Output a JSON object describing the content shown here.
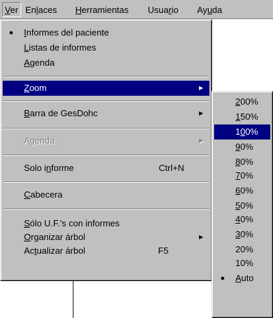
{
  "menubar": {
    "items": [
      {
        "label": "Ver",
        "underline": "V",
        "rest": "er"
      },
      {
        "label": "Enlaces",
        "pre": "En",
        "underline": "l",
        "rest": "aces"
      },
      {
        "label": "Herramientas",
        "underline": "H",
        "rest": "erramientas"
      },
      {
        "label": "Usuario",
        "pre": "Usua",
        "underline": "r",
        "rest": "io"
      },
      {
        "label": "Ayuda",
        "pre": "Ay",
        "underline": "u",
        "rest": "da"
      }
    ]
  },
  "view_menu": {
    "informes_paciente": {
      "underline": "I",
      "rest": "nformes del paciente"
    },
    "listas_informes": {
      "underline": "L",
      "rest": "istas de informes"
    },
    "agenda": {
      "underline": "A",
      "rest": "genda"
    },
    "zoom": {
      "underline": "Z",
      "rest": "oom"
    },
    "barra": {
      "underline": "B",
      "rest": "arra de GesDohc"
    },
    "agenda_disabled": "Agenda",
    "solo_informe": {
      "pre": "Solo i",
      "underline": "n",
      "rest": "forme",
      "shortcut": "Ctrl+N"
    },
    "cabecera": {
      "underline": "C",
      "rest": "abecera"
    },
    "solo_uf": {
      "underline": "S",
      "rest": "ólo U.F.'s con informes"
    },
    "organizar": {
      "underline": "O",
      "rest": "rganizar árbol"
    },
    "actualizar": {
      "pre": "Ac",
      "underline": "t",
      "rest": "ualizar árbol",
      "shortcut": "F5"
    }
  },
  "zoom_menu": {
    "z200": {
      "underline": "2",
      "rest": "00%"
    },
    "z150": {
      "underline": "1",
      "rest": "50%"
    },
    "z100": {
      "pre": "1",
      "underline": "0",
      "rest": "0%"
    },
    "z90": {
      "underline": "9",
      "rest": "0%"
    },
    "z80": {
      "underline": "8",
      "rest": "0%"
    },
    "z70": {
      "underline": "7",
      "rest": "0%"
    },
    "z60": {
      "underline": "6",
      "rest": "0%"
    },
    "z50": {
      "underline": "5",
      "rest": "0%"
    },
    "z40": {
      "underline": "4",
      "rest": "0%"
    },
    "z30": {
      "underline": "3",
      "rest": "0%"
    },
    "z20": "20%",
    "z10": "10%",
    "auto": {
      "underline": "A",
      "rest": "uto"
    }
  },
  "icons": {
    "check": "●",
    "submenu_arrow": "▶"
  },
  "colors": {
    "menu_bg": "#c0c0c0",
    "highlight_bg": "#000080",
    "highlight_text": "#ffffff",
    "disabled_text": "#808080"
  }
}
